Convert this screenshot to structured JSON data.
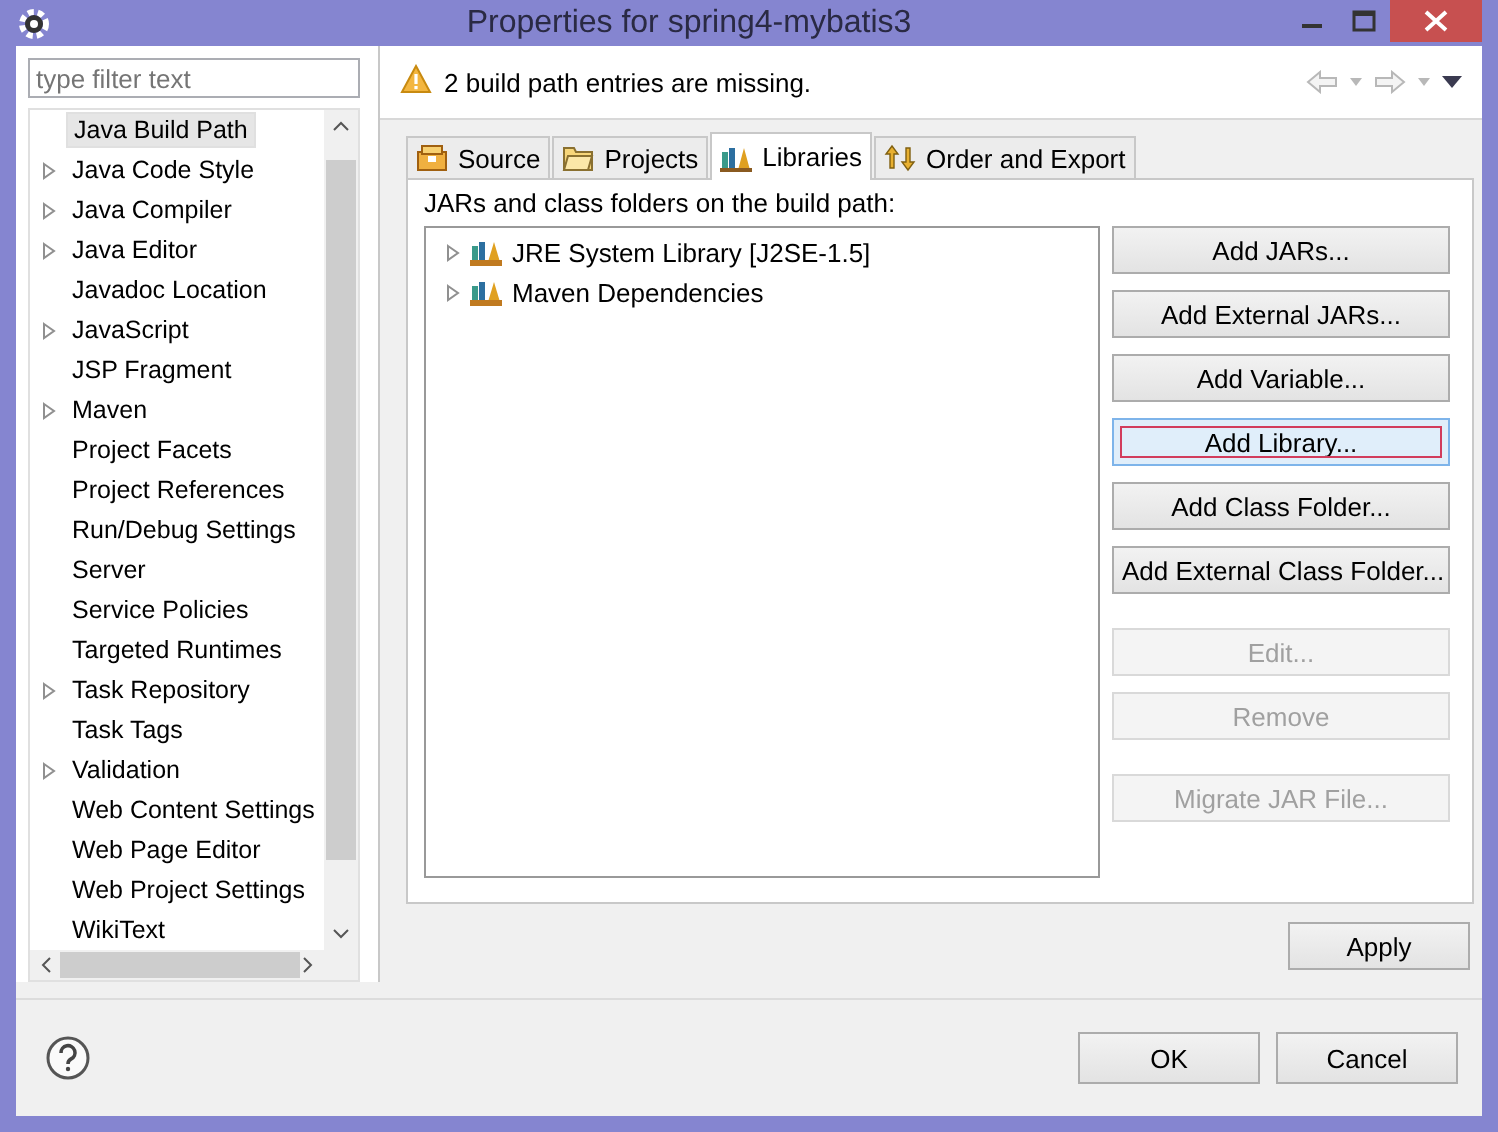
{
  "window": {
    "title": "Properties for spring4-mybatis3"
  },
  "sidebar": {
    "filter": {
      "placeholder": "type filter text"
    },
    "items": [
      {
        "label": "Java Build Path",
        "selected": true,
        "expandable": false
      },
      {
        "label": "Java Code Style",
        "selected": false,
        "expandable": true
      },
      {
        "label": "Java Compiler",
        "selected": false,
        "expandable": true
      },
      {
        "label": "Java Editor",
        "selected": false,
        "expandable": true
      },
      {
        "label": "Javadoc Location",
        "selected": false,
        "expandable": false
      },
      {
        "label": "JavaScript",
        "selected": false,
        "expandable": true
      },
      {
        "label": "JSP Fragment",
        "selected": false,
        "expandable": false
      },
      {
        "label": "Maven",
        "selected": false,
        "expandable": true
      },
      {
        "label": "Project Facets",
        "selected": false,
        "expandable": false
      },
      {
        "label": "Project References",
        "selected": false,
        "expandable": false
      },
      {
        "label": "Run/Debug Settings",
        "selected": false,
        "expandable": false
      },
      {
        "label": "Server",
        "selected": false,
        "expandable": false
      },
      {
        "label": "Service Policies",
        "selected": false,
        "expandable": false
      },
      {
        "label": "Targeted Runtimes",
        "selected": false,
        "expandable": false
      },
      {
        "label": "Task Repository",
        "selected": false,
        "expandable": true
      },
      {
        "label": "Task Tags",
        "selected": false,
        "expandable": false
      },
      {
        "label": "Validation",
        "selected": false,
        "expandable": true
      },
      {
        "label": "Web Content Settings",
        "selected": false,
        "expandable": false
      },
      {
        "label": "Web Page Editor",
        "selected": false,
        "expandable": false
      },
      {
        "label": "Web Project Settings",
        "selected": false,
        "expandable": false
      },
      {
        "label": "WikiText",
        "selected": false,
        "expandable": false
      }
    ]
  },
  "message": {
    "kind": "warning",
    "text": "2 build path entries are missing."
  },
  "tabs": [
    {
      "label": "Source",
      "kind": "source",
      "selected": false
    },
    {
      "label": "Projects",
      "kind": "projects",
      "selected": false
    },
    {
      "label": "Libraries",
      "kind": "libraries",
      "selected": true
    },
    {
      "label": "Order and Export",
      "kind": "order",
      "selected": false
    }
  ],
  "libraries": {
    "caption": "JARs and class folders on the build path:",
    "entries": [
      {
        "label": "JRE System Library [J2SE-1.5]",
        "expanded": false
      },
      {
        "label": "Maven Dependencies",
        "expanded": false
      }
    ],
    "button_groups": [
      [
        {
          "label": "Add JARs...",
          "disabled": false,
          "focused": false
        },
        {
          "label": "Add External JARs...",
          "disabled": false,
          "focused": false
        },
        {
          "label": "Add Variable...",
          "disabled": false,
          "focused": false
        },
        {
          "label": "Add Library...",
          "disabled": false,
          "focused": true
        },
        {
          "label": "Add Class Folder...",
          "disabled": false,
          "focused": false
        },
        {
          "label": "Add External Class Folder...",
          "disabled": false,
          "focused": false
        }
      ],
      [
        {
          "label": "Edit...",
          "disabled": true,
          "focused": false
        },
        {
          "label": "Remove",
          "disabled": true,
          "focused": false
        }
      ],
      [
        {
          "label": "Migrate JAR File...",
          "disabled": true,
          "focused": false
        }
      ]
    ]
  },
  "apply": "Apply",
  "buttons": [
    "OK",
    "Cancel"
  ]
}
